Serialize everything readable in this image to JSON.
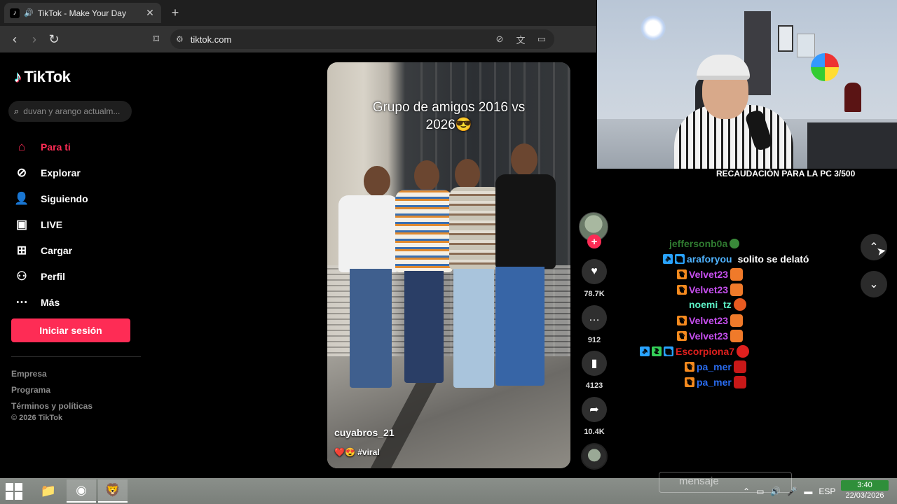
{
  "browser": {
    "tab_title": "TikTok - Make Your Day",
    "url": "tiktok.com"
  },
  "tiktok": {
    "brand": "TikTok",
    "search_placeholder": "duvan y arango actualm...",
    "menu": [
      {
        "label": "Para ti",
        "icon": "home-icon",
        "active": true
      },
      {
        "label": "Explorar",
        "icon": "compass-icon",
        "active": false
      },
      {
        "label": "Siguiendo",
        "icon": "following-icon",
        "active": false
      },
      {
        "label": "LIVE",
        "icon": "live-tv-icon",
        "active": false
      },
      {
        "label": "Cargar",
        "icon": "upload-icon",
        "active": false
      },
      {
        "label": "Perfil",
        "icon": "profile-icon",
        "active": false
      },
      {
        "label": "Más",
        "icon": "more-icon",
        "active": false
      }
    ],
    "login_label": "Iniciar sesión",
    "footer_links": [
      "Empresa",
      "Programa",
      "Términos y políticas"
    ],
    "copyright": "© 2026 TikTok",
    "accent": "#fe2c55"
  },
  "video": {
    "caption_line1": "Grupo de amigos 2016 vs",
    "caption_line2": "2026😎",
    "username": "cuyabros_21",
    "tags": "❤️😍 #viral"
  },
  "actions": {
    "likes": "78.7K",
    "comments": "912",
    "saves": "4123",
    "shares": "10.4K"
  },
  "stream": {
    "donation_text": "RECAUDACIÓN PARA LA PC 3/500"
  },
  "chat": [
    {
      "user": "jeffersonb0a",
      "message": "",
      "color": "#2f7a30",
      "badges": [],
      "emote": "#3a8a3a"
    },
    {
      "user": "araforyou",
      "message": "solito se delató",
      "color": "#4fb3ff",
      "badges": [
        "sub",
        "mod"
      ],
      "emote": ""
    },
    {
      "user": "Velvet23",
      "message": "",
      "color": "#c74ff0",
      "badges": [
        "crown"
      ],
      "emote": "#f07a2a"
    },
    {
      "user": "Velvet23",
      "message": "",
      "color": "#c74ff0",
      "badges": [
        "crown"
      ],
      "emote": "#f07a2a"
    },
    {
      "user": "noemi_tz",
      "message": "",
      "color": "#5cf0c5",
      "badges": [],
      "emote": "#e85a20"
    },
    {
      "user": "Velvet23",
      "message": "",
      "color": "#c74ff0",
      "badges": [
        "crown"
      ],
      "emote": "#f07a2a"
    },
    {
      "user": "Velvet23",
      "message": "",
      "color": "#c74ff0",
      "badges": [
        "crown"
      ],
      "emote": "#f07a2a"
    },
    {
      "user": "Escorpiona7",
      "message": "",
      "color": "#e0201e",
      "badges": [
        "sub",
        "mod",
        "mod"
      ],
      "emote": "#e0201e"
    },
    {
      "user": "pa_mer",
      "message": "",
      "color": "#2a6cf0",
      "badges": [
        "crown"
      ],
      "emote": "#c81818"
    },
    {
      "user": "pa_mer",
      "message": "",
      "color": "#2a6cf0",
      "badges": [
        "crown"
      ],
      "emote": "#c81818"
    }
  ],
  "taskbar": {
    "message_placeholder": "mensaje",
    "language": "ESP",
    "time": "3:40",
    "date": "22/03/2026"
  }
}
